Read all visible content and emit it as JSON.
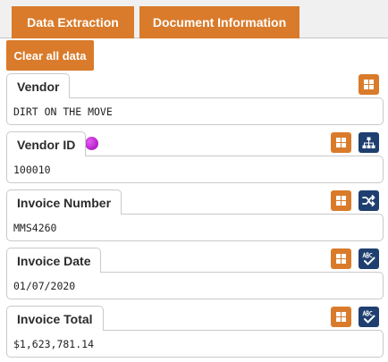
{
  "tabs": [
    {
      "label": "Data Extraction"
    },
    {
      "label": "Document Information"
    }
  ],
  "toolbar": {
    "clear_label": "Clear all data"
  },
  "fields": [
    {
      "label": "Vendor",
      "value": "DIRT ON THE MOVE",
      "icons": [
        "grid-icon"
      ]
    },
    {
      "label": "Vendor ID",
      "value": "100010",
      "status": "purple-dot",
      "icons": [
        "grid-icon",
        "hierarchy-icon"
      ]
    },
    {
      "label": "Invoice Number",
      "value": "MMS4260",
      "icons": [
        "grid-icon",
        "shuffle-icon"
      ]
    },
    {
      "label": "Invoice Date",
      "value": "01/07/2020",
      "icons": [
        "grid-icon",
        "spellcheck-icon"
      ]
    },
    {
      "label": "Invoice Total",
      "value": "$1,623,781.14",
      "icons": [
        "grid-icon",
        "spellcheck-icon"
      ]
    }
  ],
  "colors": {
    "accent": "#d97b2b",
    "navy": "#1f3f70",
    "status_dot": "#b400c8"
  }
}
